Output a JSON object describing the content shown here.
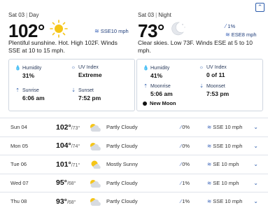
{
  "day": {
    "date": "Sat 03",
    "label": "Day",
    "temp": "102°",
    "wind": "SSE10 mph",
    "description_line1": "Plentiful sunshine. Hot. High 102F. Winds",
    "description_line2": "SSE at 10 to 15 mph.",
    "humidity_label": "Humidity",
    "humidity": "31%",
    "uv_label": "UV Index",
    "uv": "Extreme",
    "sunrise_label": "Sunrise",
    "sunrise": "6:06 am",
    "sunset_label": "Sunset",
    "sunset": "7:52 pm"
  },
  "night": {
    "date": "Sat 03",
    "label": "Night",
    "temp": "73°",
    "precip": "1%",
    "wind": "ESE8 mph",
    "description_line1": "Clear skies. Low 73F. Winds ESE at 5 to 10",
    "description_line2": "mph.",
    "humidity_label": "Humidity",
    "humidity": "41%",
    "uv_label": "UV Index",
    "uv": "0 of 11",
    "moonrise_label": "Moonrise",
    "moonrise": "5:06 am",
    "moonset_label": "Moonset",
    "moonset": "7:53 pm",
    "moon_phase": "New Moon"
  },
  "forecast": [
    {
      "day": "Sun 04",
      "high": "102°",
      "low": "/73°",
      "icon": "partly-cloudy-icon",
      "condition": "Partly Cloudy",
      "precip": "0%",
      "wind": "SSE 10 mph"
    },
    {
      "day": "Mon 05",
      "high": "104°",
      "low": "/74°",
      "icon": "partly-cloudy-icon",
      "condition": "Partly Cloudy",
      "precip": "0%",
      "wind": "SSE 10 mph"
    },
    {
      "day": "Tue 06",
      "high": "101°",
      "low": "/71°",
      "icon": "mostly-sunny-icon",
      "condition": "Mostly Sunny",
      "precip": "0%",
      "wind": "SE 10 mph"
    },
    {
      "day": "Wed 07",
      "high": "95°",
      "low": "/68°",
      "icon": "partly-cloudy-icon",
      "condition": "Partly Cloudy",
      "precip": "1%",
      "wind": "SE 10 mph"
    },
    {
      "day": "Thu 08",
      "high": "93°",
      "low": "/68°",
      "icon": "partly-cloudy-icon",
      "condition": "Partly Cloudy",
      "precip": "1%",
      "wind": "SSE 10 mph"
    }
  ],
  "colors": {
    "accent": "#2c5cab",
    "sun": "#f5c518",
    "border": "#cfd6e0"
  }
}
